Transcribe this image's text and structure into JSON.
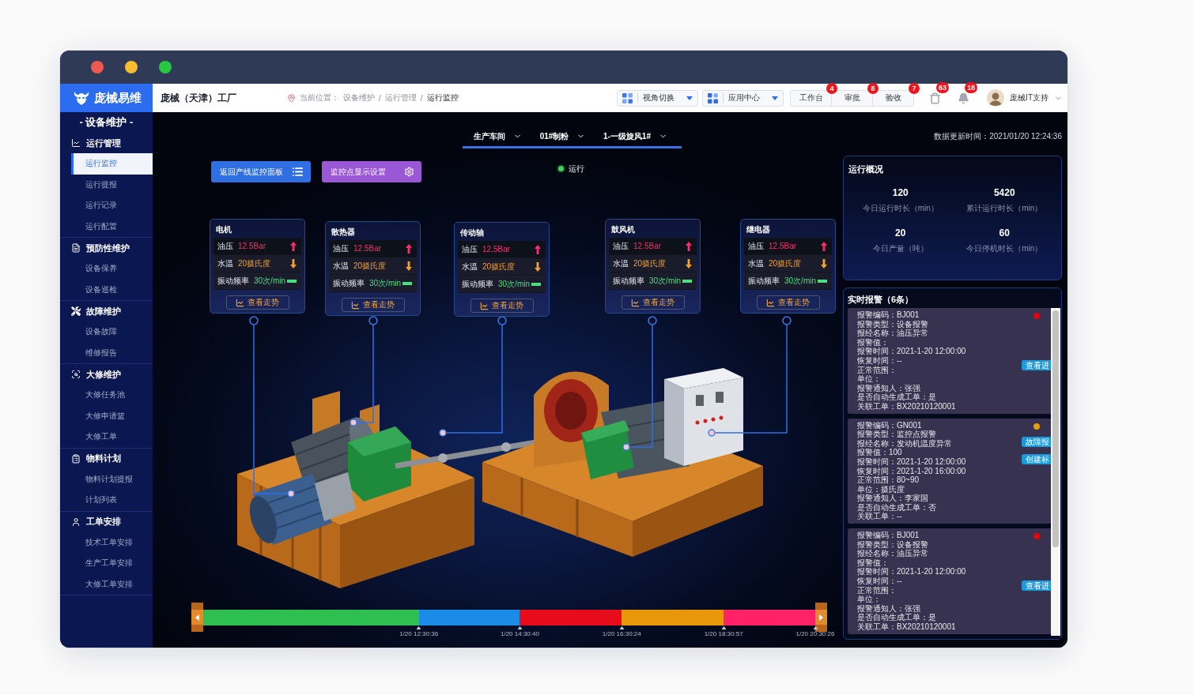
{
  "header": {
    "brand": "庞械易维",
    "factory": "庞械（天津）工厂",
    "breadcrumb": {
      "label": "当前位置：",
      "items": [
        {
          "text": "设备维护",
          "selected": false
        },
        {
          "text": "运行管理",
          "selected": false
        },
        {
          "text": "运行监控",
          "selected": true
        }
      ],
      "separators": [
        "/",
        "/"
      ]
    },
    "dropdowns": [
      {
        "label": "视角切换"
      },
      {
        "label": "应用中心"
      }
    ],
    "actions": [
      {
        "label": "工作台",
        "badge": "4"
      },
      {
        "label": "审批",
        "badge": "8"
      },
      {
        "label": "验收",
        "badge": "7"
      }
    ],
    "notifications": [
      {
        "badge": "63"
      },
      {
        "badge": "18"
      }
    ],
    "user": {
      "name": "庞械IT支持"
    }
  },
  "sidebar": {
    "title": "- 设备维护 -",
    "groups": [
      {
        "label": "运行管理",
        "items": [
          {
            "label": "运行监控",
            "selected": true
          },
          {
            "label": "运行提报",
            "selected": false
          },
          {
            "label": "运行记录",
            "selected": false
          },
          {
            "label": "运行配置",
            "selected": false
          }
        ]
      },
      {
        "label": "预防性维护",
        "items": [
          {
            "label": "设备保养",
            "selected": false
          },
          {
            "label": "设备巡检",
            "selected": false
          }
        ]
      },
      {
        "label": "故障维护",
        "items": [
          {
            "label": "设备故障",
            "selected": false
          },
          {
            "label": "维修报告",
            "selected": false
          }
        ]
      },
      {
        "label": "大修维护",
        "items": [
          {
            "label": "大修任务池",
            "selected": false
          },
          {
            "label": "大修申请篮",
            "selected": false
          },
          {
            "label": "大修工单",
            "selected": false
          }
        ]
      },
      {
        "label": "物料计划",
        "items": [
          {
            "label": "物料计划提报",
            "selected": false
          },
          {
            "label": "计划列表",
            "selected": false
          }
        ]
      },
      {
        "label": "工单安排",
        "items": [
          {
            "label": "技术工单安排",
            "selected": false
          },
          {
            "label": "生产工单安排",
            "selected": false
          },
          {
            "label": "大修工单安排",
            "selected": false
          }
        ]
      }
    ]
  },
  "monitor": {
    "selectors": [
      "生产车间",
      "01#制粉",
      "1-一级旋风1#"
    ],
    "buttons": [
      {
        "label": "返回产线监控面板",
        "kind": "list"
      },
      {
        "label": "监控点显示设置",
        "kind": "settings"
      }
    ],
    "status": {
      "label": "运行",
      "kind": "running"
    },
    "cards": [
      {
        "title": "电机",
        "rows": [
          {
            "label": "油压",
            "value": "12.5Bar",
            "color": "#ff2d6b",
            "kind": "up"
          },
          {
            "label": "水温",
            "value": "20摄氏度",
            "color": "#f5a033",
            "kind": "down"
          },
          {
            "label": "振动频率",
            "value": "30次/min",
            "color": "#4ade80",
            "kind": "flat"
          }
        ],
        "button": "查看走势"
      },
      {
        "title": "散热器",
        "rows": [
          {
            "label": "油压",
            "value": "12.5Bar",
            "color": "#ff2d6b",
            "kind": "up"
          },
          {
            "label": "水温",
            "value": "20摄氏度",
            "color": "#f5a033",
            "kind": "down"
          },
          {
            "label": "振动频率",
            "value": "30次/min",
            "color": "#4ade80",
            "kind": "flat"
          }
        ],
        "button": "查看走势"
      },
      {
        "title": "传动轴",
        "rows": [
          {
            "label": "油压",
            "value": "12.5Bar",
            "color": "#ff2d6b",
            "kind": "up"
          },
          {
            "label": "水温",
            "value": "20摄氏度",
            "color": "#f5a033",
            "kind": "down"
          },
          {
            "label": "振动频率",
            "value": "30次/min",
            "color": "#4ade80",
            "kind": "flat"
          }
        ],
        "button": "查看走势"
      },
      {
        "title": "鼓风机",
        "rows": [
          {
            "label": "油压",
            "value": "12.5Bar",
            "color": "#ff2d6b",
            "kind": "up"
          },
          {
            "label": "水温",
            "value": "20摄氏度",
            "color": "#f5a033",
            "kind": "down"
          },
          {
            "label": "振动频率",
            "value": "30次/min",
            "color": "#4ade80",
            "kind": "flat"
          }
        ],
        "button": "查看走势"
      },
      {
        "title": "继电器",
        "rows": [
          {
            "label": "油压",
            "value": "12.5Bar",
            "color": "#ff2d6b",
            "kind": "up"
          },
          {
            "label": "水温",
            "value": "20摄氏度",
            "color": "#f5a033",
            "kind": "down"
          },
          {
            "label": "振动频率",
            "value": "30次/min",
            "color": "#4ade80",
            "kind": "flat"
          }
        ],
        "button": "查看走势"
      }
    ],
    "timeline": {
      "segments": [
        {
          "color": "#2dbf4f",
          "label": "1/20 12:30:36"
        },
        {
          "color": "#1a8ce8",
          "label": "1/20 14:30:40"
        },
        {
          "color": "#e60c1c",
          "label": "1/20 16:30:24"
        },
        {
          "color": "#e8960a",
          "label": "1/20 18:30:57"
        },
        {
          "color": "#ff2266",
          "label": "1/20 20:30:26"
        }
      ]
    }
  },
  "update_time": "数据更新时间：2021/01/20 12:24:36",
  "overview": {
    "title": "运行概况",
    "stats": [
      {
        "value": "120",
        "label": "今日运行时长（min）"
      },
      {
        "value": "5420",
        "label": "累计运行时长（min）"
      },
      {
        "value": "20",
        "label": "今日产量（吨）"
      },
      {
        "value": "60",
        "label": "今日停机时长（min）"
      }
    ]
  },
  "alarms": {
    "title": "实时报警（6条）",
    "items": [
      {
        "color": "#e60012",
        "lines": [
          "报警编码：BJ001",
          "报警类型：设备报警",
          "报经名称：油压异常",
          "报警值：",
          "报警时间：2021-1-20 12:00:00",
          "恢复时间：--",
          "正常范围：",
          "单位：",
          "报警通知人：张强",
          "是否自动生成工单：是",
          "关联工单：BX20210120001"
        ],
        "actions": [
          "查看进"
        ]
      },
      {
        "color": "#e89b0c",
        "lines": [
          "报警编码：GN001",
          "报警类型：监控点报警",
          "报经名称：发动机温度异常",
          "报警值：100",
          "报警时间：2021-1-20 12:00:00",
          "恢复时间：2021-1-20 16:00:00",
          "正常范围：80~90",
          "单位：摄氏度",
          "报警通知人：李家国",
          "是否自动生成工单：否",
          "关联工单：--"
        ],
        "actions": [
          "故障报",
          "创建标"
        ]
      },
      {
        "color": "#e60012",
        "lines": [
          "报警编码：BJ001",
          "报警类型：设备报警",
          "报经名称：油压异常",
          "报警值：",
          "报警时间：2021-1-20 12:00:00",
          "恢复时间：--",
          "正常范围：",
          "单位：",
          "报警通知人：张强",
          "是否自动生成工单：是",
          "关联工单：BX20210120001"
        ],
        "actions": [
          "查看进"
        ]
      }
    ]
  }
}
